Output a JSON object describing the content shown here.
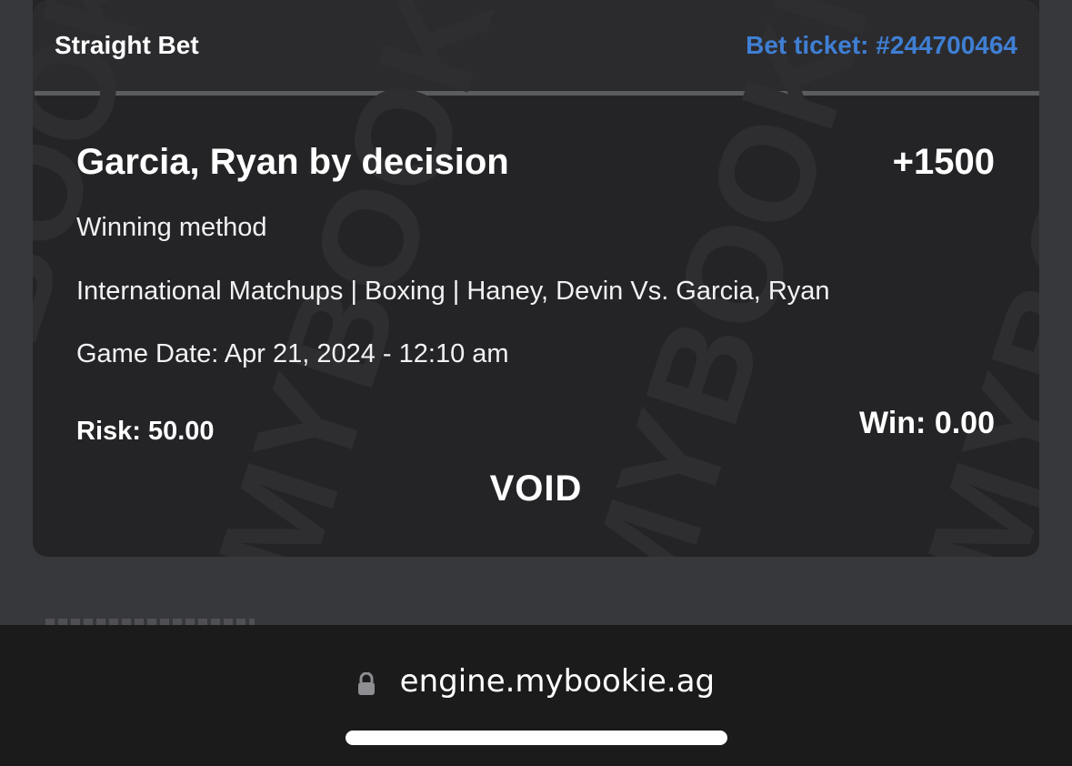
{
  "ticket": {
    "bet_type": "Straight Bet",
    "ticket_number": "Bet ticket: #244700464",
    "selection": "Garcia, Ryan by decision",
    "odds": "+1500",
    "market": "Winning method",
    "event": "International Matchups | Boxing | Haney, Devin Vs. Garcia, Ryan",
    "game_date": "Game Date: Apr 21, 2024 - 12:10 am",
    "risk": "Risk: 50.00",
    "win": "Win: 0.00",
    "status": "VOID",
    "watermark_text": "MYBOOKIE"
  },
  "browser": {
    "url": "engine.mybookie.ag",
    "lock_icon": "lock-icon"
  },
  "colors": {
    "page_background": "#37383b",
    "ticket_background": "#242427",
    "header_background": "#2b2b2e",
    "link_blue": "#3f7fd4",
    "browser_bar": "#1b1b1c"
  }
}
